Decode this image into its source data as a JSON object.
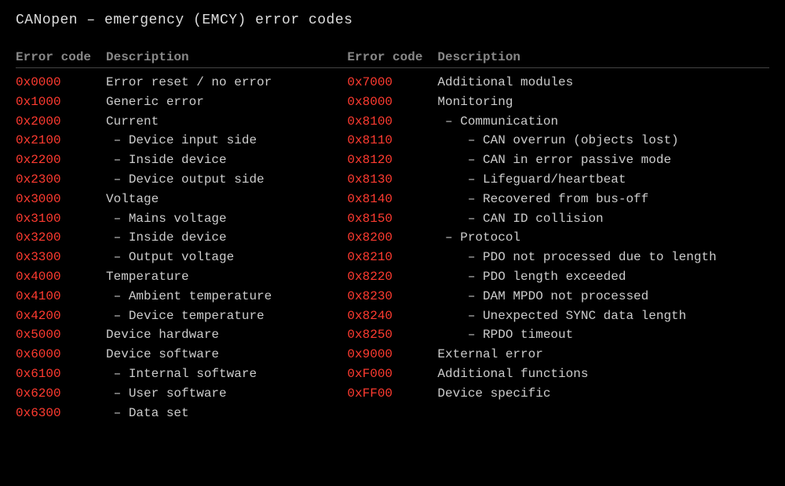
{
  "title": "CANopen – emergency (EMCY) error codes",
  "headers": {
    "code": "Error code",
    "desc": "Description"
  },
  "left": [
    {
      "code": "0x0000",
      "desc": "Error reset / no error"
    },
    {
      "code": "0x1000",
      "desc": "Generic error"
    },
    {
      "code": "0x2000",
      "desc": "Current"
    },
    {
      "code": "0x2100",
      "desc": " – Device input side"
    },
    {
      "code": "0x2200",
      "desc": " – Inside device"
    },
    {
      "code": "0x2300",
      "desc": " – Device output side"
    },
    {
      "code": "0x3000",
      "desc": "Voltage"
    },
    {
      "code": "0x3100",
      "desc": " – Mains voltage"
    },
    {
      "code": "0x3200",
      "desc": " – Inside device"
    },
    {
      "code": "0x3300",
      "desc": " – Output voltage"
    },
    {
      "code": "0x4000",
      "desc": "Temperature"
    },
    {
      "code": "0x4100",
      "desc": " – Ambient temperature"
    },
    {
      "code": "0x4200",
      "desc": " – Device temperature"
    },
    {
      "code": "0x5000",
      "desc": "Device hardware"
    },
    {
      "code": "0x6000",
      "desc": "Device software"
    },
    {
      "code": "0x6100",
      "desc": " – Internal software"
    },
    {
      "code": "0x6200",
      "desc": " – User software"
    },
    {
      "code": "0x6300",
      "desc": " – Data set"
    }
  ],
  "right": [
    {
      "code": "0x7000",
      "desc": "Additional modules"
    },
    {
      "code": "0x8000",
      "desc": "Monitoring"
    },
    {
      "code": "0x8100",
      "desc": " – Communication"
    },
    {
      "code": "0x8110",
      "desc": "    – CAN overrun (objects lost)"
    },
    {
      "code": "0x8120",
      "desc": "    – CAN in error passive mode"
    },
    {
      "code": "0x8130",
      "desc": "    – Lifeguard/heartbeat"
    },
    {
      "code": "0x8140",
      "desc": "    – Recovered from bus-off"
    },
    {
      "code": "0x8150",
      "desc": "    – CAN ID collision"
    },
    {
      "code": "0x8200",
      "desc": " – Protocol"
    },
    {
      "code": "0x8210",
      "desc": "    – PDO not processed due to length"
    },
    {
      "code": "0x8220",
      "desc": "    – PDO length exceeded"
    },
    {
      "code": "0x8230",
      "desc": "    – DAM MPDO not processed"
    },
    {
      "code": "0x8240",
      "desc": "    – Unexpected SYNC data length"
    },
    {
      "code": "0x8250",
      "desc": "    – RPDO timeout"
    },
    {
      "code": "0x9000",
      "desc": "External error"
    },
    {
      "code": "0xF000",
      "desc": "Additional functions"
    },
    {
      "code": "0xFF00",
      "desc": "Device specific"
    }
  ]
}
